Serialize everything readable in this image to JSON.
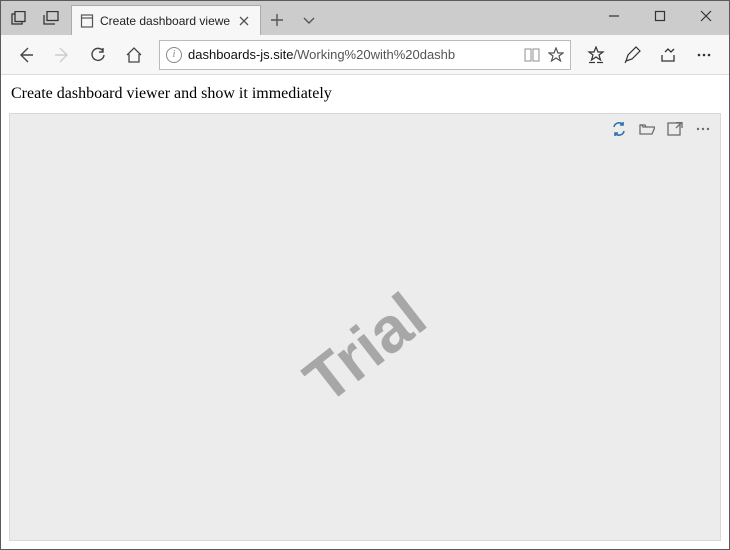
{
  "browser": {
    "tab_title": "Create dashboard viewe",
    "url_display_host": "dashboards-js.site",
    "url_display_path": "/Working%20with%20dashb"
  },
  "page": {
    "heading": "Create dashboard viewer and show it immediately",
    "watermark": "Trial"
  },
  "icons": {
    "tabs_overlap": "tabs-icon",
    "new_window": "new-window-icon",
    "page": "page-icon",
    "close": "close-icon",
    "plus": "plus-icon",
    "chevron_down": "chevron-down-icon",
    "minimize": "minimize-icon",
    "maximize": "maximize-icon",
    "back": "back-icon",
    "forward": "forward-icon",
    "refresh": "refresh-icon",
    "home": "home-icon",
    "info": "info-icon",
    "reading": "reading-icon",
    "star": "star-icon",
    "favorites": "favorites-list-icon",
    "pen": "pen-icon",
    "share": "share-icon",
    "more": "more-icon",
    "viewer_refresh": "viewer-refresh-icon",
    "viewer_open": "folder-open-icon",
    "viewer_fullscreen": "fullscreen-icon",
    "viewer_menu": "viewer-menu-icon"
  }
}
